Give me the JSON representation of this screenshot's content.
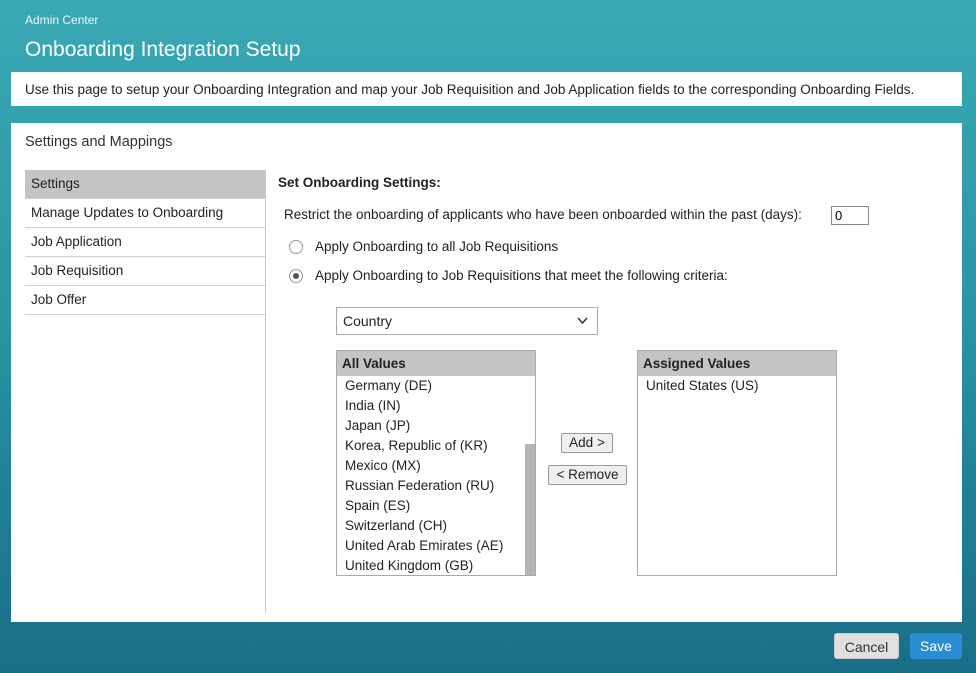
{
  "header": {
    "breadcrumb": "Admin Center",
    "title": "Onboarding Integration Setup"
  },
  "intro": "Use this page to setup your Onboarding Integration and map your Job Requisition and Job Application fields to the corresponding Onboarding Fields.",
  "panel": {
    "title": "Settings and Mappings",
    "nav": [
      "Settings",
      "Manage Updates to Onboarding",
      "Job Application",
      "Job Requisition",
      "Job Offer"
    ],
    "active_nav": "Settings"
  },
  "settings": {
    "section_title": "Set Onboarding Settings:",
    "restrict_label": "Restrict the onboarding of applicants who have been onboarded within the past (days):",
    "restrict_days": "0",
    "radio_all": "Apply Onboarding to all Job Requisitions",
    "radio_criteria": "Apply Onboarding to Job Requisitions that meet the following criteria:",
    "selected_radio": "criteria",
    "criteria_field": "Country",
    "all_values_header": "All Values",
    "all_values": [
      "Germany (DE)",
      "India (IN)",
      "Japan (JP)",
      "Korea, Republic of (KR)",
      "Mexico (MX)",
      "Russian Federation (RU)",
      "Spain (ES)",
      "Switzerland (CH)",
      "United Arab Emirates (AE)",
      "United Kingdom (GB)"
    ],
    "assigned_values_header": "Assigned Values",
    "assigned_values": [
      "United States (US)"
    ],
    "add_label": "Add >",
    "remove_label": "< Remove"
  },
  "footer": {
    "cancel": "Cancel",
    "save": "Save"
  }
}
